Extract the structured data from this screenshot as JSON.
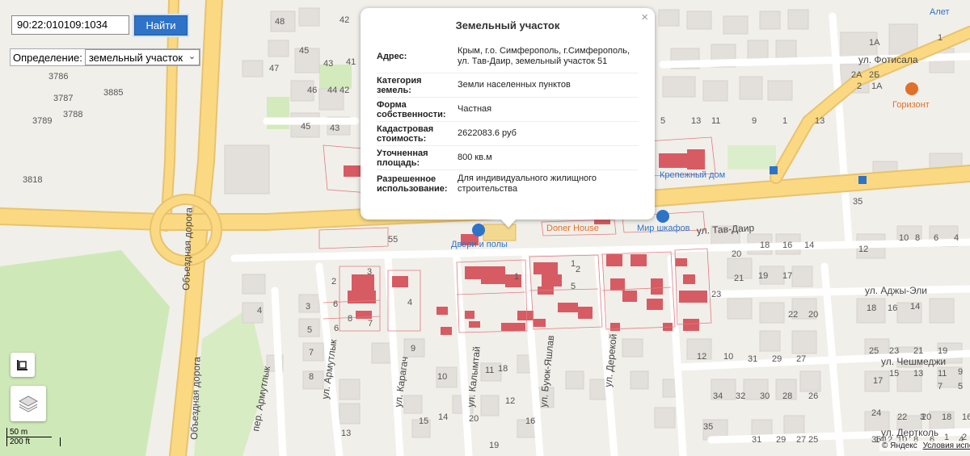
{
  "search": {
    "value": "90:22:010109:1034",
    "button_label": "Найти"
  },
  "definition": {
    "label": "Определение:",
    "selected": "земельный участок"
  },
  "popup": {
    "title": "Земельный участок",
    "close_label": "×",
    "rows": [
      {
        "key": "Адрес:",
        "value": "Крым, г.о. Симферополь, г.Симферополь, ул. Тав-Даир, земельный участок 51"
      },
      {
        "key": "Категория земель:",
        "value": "Земли населенных пунктов"
      },
      {
        "key": "Форма собственности:",
        "value": "Частная"
      },
      {
        "key": "Кадастровая стоимость:",
        "value": "2622083.6 руб"
      },
      {
        "key": "Уточненная площадь:",
        "value": "800 кв.м"
      },
      {
        "key": "Разрешенное использование:",
        "value": "Для индивидуального жилищного строительства"
      }
    ]
  },
  "map": {
    "roads": {
      "obezdnaya": "Объездная дорога",
      "fotisala": "ул. Фотисала",
      "tav_dair": "ул. Тав-Даир",
      "adzhy_eli": "ул. Аджы-Эли",
      "cheshmedzhi": "ул. Чешмеджи",
      "dertkol": "ул. Дертколь",
      "armutlyk": "ул. Армутлык",
      "per_armutlyk": "пер. Армутлык",
      "karagach": "ул. Карагач",
      "kalymtay": "ул. Калымтай",
      "buyuk_yashlav": "ул. Буюк-Яшлав",
      "derekoy": "ул. Дерекой"
    },
    "pois": {
      "alet": "Алет",
      "gorizont": "Горизонт",
      "krepezhny": "Крепежный дом",
      "doner": "Doner House",
      "mir_shkafov": "Мир шкафов",
      "dveri": "Двери и полы"
    },
    "numbers_left": [
      "48",
      "42",
      "45",
      "47",
      "43",
      "41",
      "46",
      "44",
      "42",
      "45",
      "43",
      "3786",
      "3885",
      "3787",
      "3789",
      "3788",
      "3818",
      "55"
    ],
    "numbers_right": [
      "1",
      "1А",
      "2А",
      "2Б",
      "2",
      "1А",
      "5",
      "13",
      "11",
      "9",
      "1",
      "13",
      "35",
      "20",
      "18",
      "16",
      "14",
      "12",
      "10",
      "8",
      "6",
      "4",
      "21",
      "19",
      "17",
      "23",
      "22",
      "20",
      "18",
      "16",
      "14",
      "12",
      "10",
      "31",
      "29",
      "27",
      "25",
      "23",
      "21",
      "19",
      "17",
      "15",
      "13",
      "11",
      "9",
      "24",
      "22",
      "20",
      "18",
      "16",
      "34",
      "32",
      "30",
      "28",
      "26",
      "36",
      "35",
      "31",
      "29",
      "27",
      "25",
      "7",
      "5",
      "3",
      "1",
      "2",
      "4",
      "6",
      "8",
      "10",
      "12",
      "14",
      "16"
    ],
    "numbers_lower": [
      "2",
      "4",
      "3",
      "5",
      "6",
      "7",
      "8",
      "9",
      "10",
      "11",
      "12",
      "13",
      "14",
      "15",
      "16",
      "18",
      "19",
      "20",
      "2",
      "1",
      "3",
      "4",
      "5",
      "6",
      "7",
      "8",
      "1"
    ]
  },
  "controls": {
    "ruler_icon": "ruler-icon",
    "layers_icon": "layers-icon"
  },
  "scale": {
    "metric": "50 m",
    "imperial": "200 ft"
  },
  "copyright": {
    "text": "© Яндекс",
    "terms": "Условия испо"
  },
  "colors": {
    "accent": "#2f73c8",
    "parcel": "#d75b63",
    "road_major": "#fbd983",
    "poi_orange": "#e0702a",
    "poi_blue": "#2f73c8"
  }
}
